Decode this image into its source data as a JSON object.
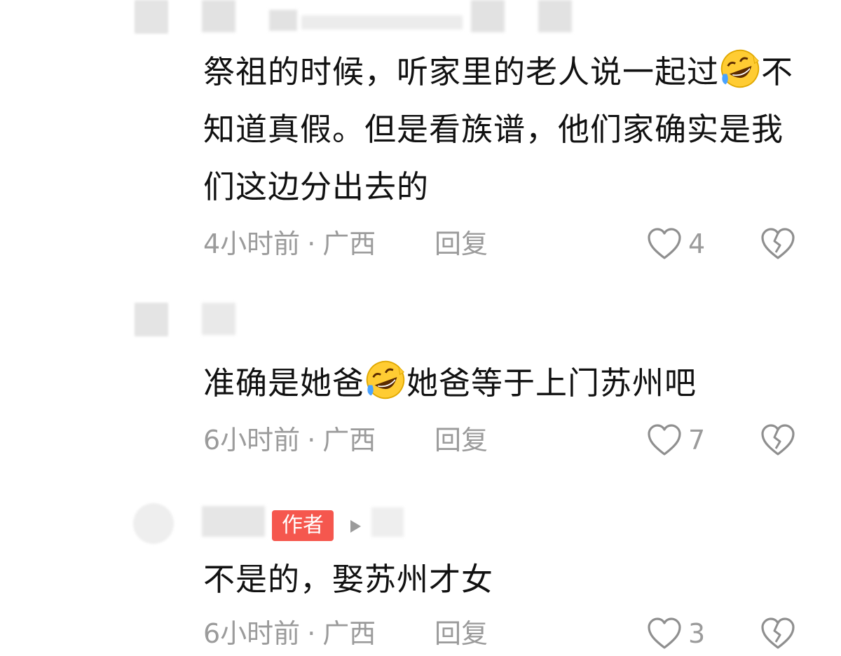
{
  "comments": [
    {
      "text_parts": [
        "祭祖的时候，听家里的老人说一起过",
        "不知道真假。但是看族谱，他们家确实是我们这边分出去的"
      ],
      "emoji": "rolling-laughing-emoji",
      "time": "4小时前",
      "separator": "·",
      "location": "广西",
      "reply_label": "回复",
      "likes": "4"
    },
    {
      "text_parts": [
        "准确是她爸",
        "她爸等于上门苏州吧"
      ],
      "emoji": "rolling-laughing-emoji",
      "time": "6小时前",
      "separator": "·",
      "location": "广西",
      "reply_label": "回复",
      "likes": "7"
    },
    {
      "author_badge": "作者",
      "text": "不是的，娶苏州才女",
      "time": "6小时前",
      "separator": "·",
      "location": "广西",
      "reply_label": "回复",
      "likes": "3"
    }
  ],
  "icons": {
    "like": "heart-outline-icon",
    "dislike": "broken-heart-icon",
    "reply_arrow": "play-triangle-icon"
  },
  "colors": {
    "meta_gray": "#9b9b9b",
    "badge_red": "#f5574e",
    "text_dark": "#111111"
  }
}
